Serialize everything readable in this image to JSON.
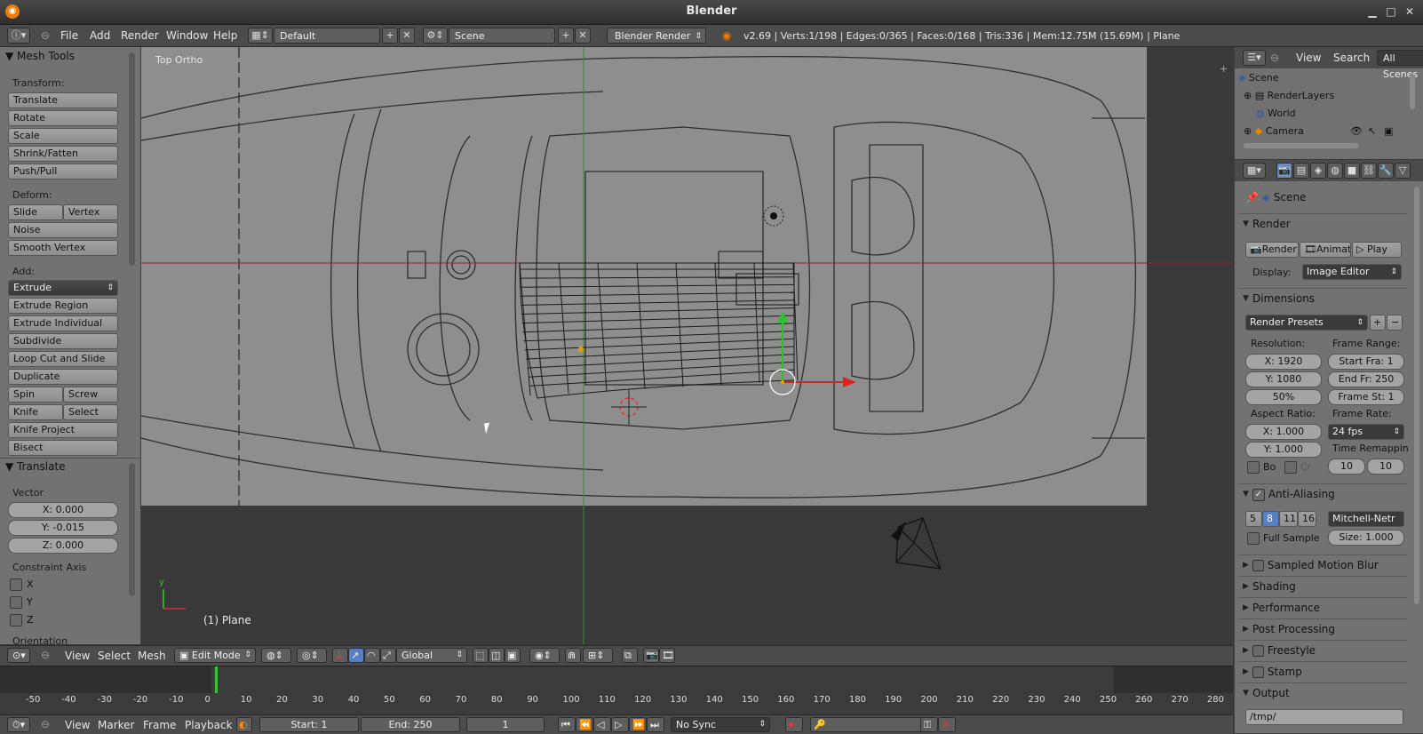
{
  "window": {
    "title": "Blender"
  },
  "info_header": {
    "menus": [
      "File",
      "Add",
      "Render",
      "Window",
      "Help"
    ],
    "screen_layout": "Default",
    "scene": "Scene",
    "render_engine": "Blender Render",
    "stats": "v2.69 | Verts:1/198 | Edges:0/365 | Faces:0/168 | Tris:336 | Mem:12.75M (15.69M) | Plane"
  },
  "toolshelf": {
    "panel_title": "Mesh Tools",
    "transform_label": "Transform:",
    "translate": "Translate",
    "rotate": "Rotate",
    "scale": "Scale",
    "shrink_fatten": "Shrink/Fatten",
    "push_pull": "Push/Pull",
    "deform_label": "Deform:",
    "slide_edge": "Slide Edge",
    "vertex": "Vertex",
    "noise": "Noise",
    "smooth_vertex": "Smooth Vertex",
    "add_label": "Add:",
    "extrude": "Extrude",
    "extrude_region": "Extrude Region",
    "extrude_individual": "Extrude Individual",
    "subdivide": "Subdivide",
    "loop_cut": "Loop Cut and Slide",
    "duplicate": "Duplicate",
    "spin": "Spin",
    "screw": "Screw",
    "knife": "Knife",
    "select": "Select",
    "knife_project": "Knife Project",
    "bisect": "Bisect"
  },
  "operator_panel": {
    "title": "Translate",
    "vector_label": "Vector",
    "x": "X: 0.000",
    "y": "Y: -0.015",
    "z": "Z: 0.000",
    "constraint_label": "Constraint Axis",
    "axis_x": "X",
    "axis_y": "Y",
    "axis_z": "Z",
    "orientation_label": "Orientation"
  },
  "viewport": {
    "view_name": "Top Ortho",
    "object_label": "(1) Plane",
    "axis_y": "y"
  },
  "outliner": {
    "menus": [
      "View",
      "Search"
    ],
    "filter": "All Scenes",
    "items": [
      "Scene",
      "RenderLayers",
      "World",
      "Camera"
    ]
  },
  "properties": {
    "context": "Scene",
    "render_panel": "Render",
    "render_btn": "Render",
    "anim_btn": "Animati",
    "play_btn": "Play",
    "display_label": "Display:",
    "display_value": "Image Editor",
    "dimensions_panel": "Dimensions",
    "render_presets": "Render Presets",
    "resolution_label": "Resolution:",
    "res_x": "X: 1920",
    "res_y": "Y: 1080",
    "res_pct": "50%",
    "frame_range_label": "Frame Range:",
    "start_fra": "Start Fra: 1",
    "end_fr": "End Fr: 250",
    "frame_st": "Frame St: 1",
    "aspect_label": "Aspect Ratio:",
    "asp_x": "X: 1.000",
    "asp_y": "Y: 1.000",
    "frame_rate_label": "Frame Rate:",
    "fps": "24 fps",
    "time_remap_label": "Time Remappin",
    "bo": "Bo",
    "cr": "Cr",
    "remap_old": "10",
    "remap_new": "10",
    "aa_panel": "Anti-Aliasing",
    "aa_samples": [
      "5",
      "8",
      "11",
      "16"
    ],
    "aa_filter": "Mitchell-Netr",
    "full_sample": "Full Sample",
    "aa_size": "Size: 1.000",
    "panels": [
      "Sampled Motion Blur",
      "Shading",
      "Performance",
      "Post Processing",
      "Freestyle",
      "Stamp",
      "Output"
    ],
    "output_path": "/tmp/"
  },
  "view3d_header": {
    "menus": [
      "View",
      "Select",
      "Mesh"
    ],
    "mode": "Edit Mode",
    "orientation": "Global"
  },
  "timeline": {
    "ticks": [
      "-50",
      "-40",
      "-30",
      "-20",
      "-10",
      "0",
      "10",
      "20",
      "30",
      "40",
      "50",
      "60",
      "70",
      "80",
      "90",
      "100",
      "110",
      "120",
      "130",
      "140",
      "150",
      "160",
      "170",
      "180",
      "190",
      "200",
      "210",
      "220",
      "230",
      "240",
      "250",
      "260",
      "270",
      "280"
    ],
    "current_frame": 1,
    "menus": [
      "View",
      "Marker",
      "Frame",
      "Playback"
    ],
    "start": "Start: 1",
    "end": "End: 250",
    "frame": "1",
    "sync": "No Sync"
  }
}
